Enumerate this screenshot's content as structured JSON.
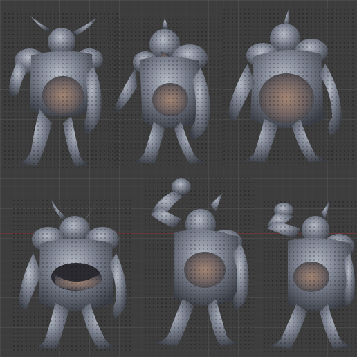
{
  "viewport": {
    "background": "#3d3d3d",
    "grid_color": "#4a4a4a",
    "axis_color": "#7a3a3a"
  },
  "model": {
    "skin_base": "#6f7580",
    "skin_dark": "#3a3e46",
    "skin_light": "#b6bcc6",
    "skin_warm": "#8a6f62"
  },
  "figures": [
    {
      "pose": "standing-front-horns-wide"
    },
    {
      "pose": "standing-three-quarter-tongue"
    },
    {
      "pose": "standing-front-single-horn"
    },
    {
      "pose": "standing-mouth-belly-open"
    },
    {
      "pose": "arm-raised-fist"
    },
    {
      "pose": "arm-raised-side"
    }
  ]
}
